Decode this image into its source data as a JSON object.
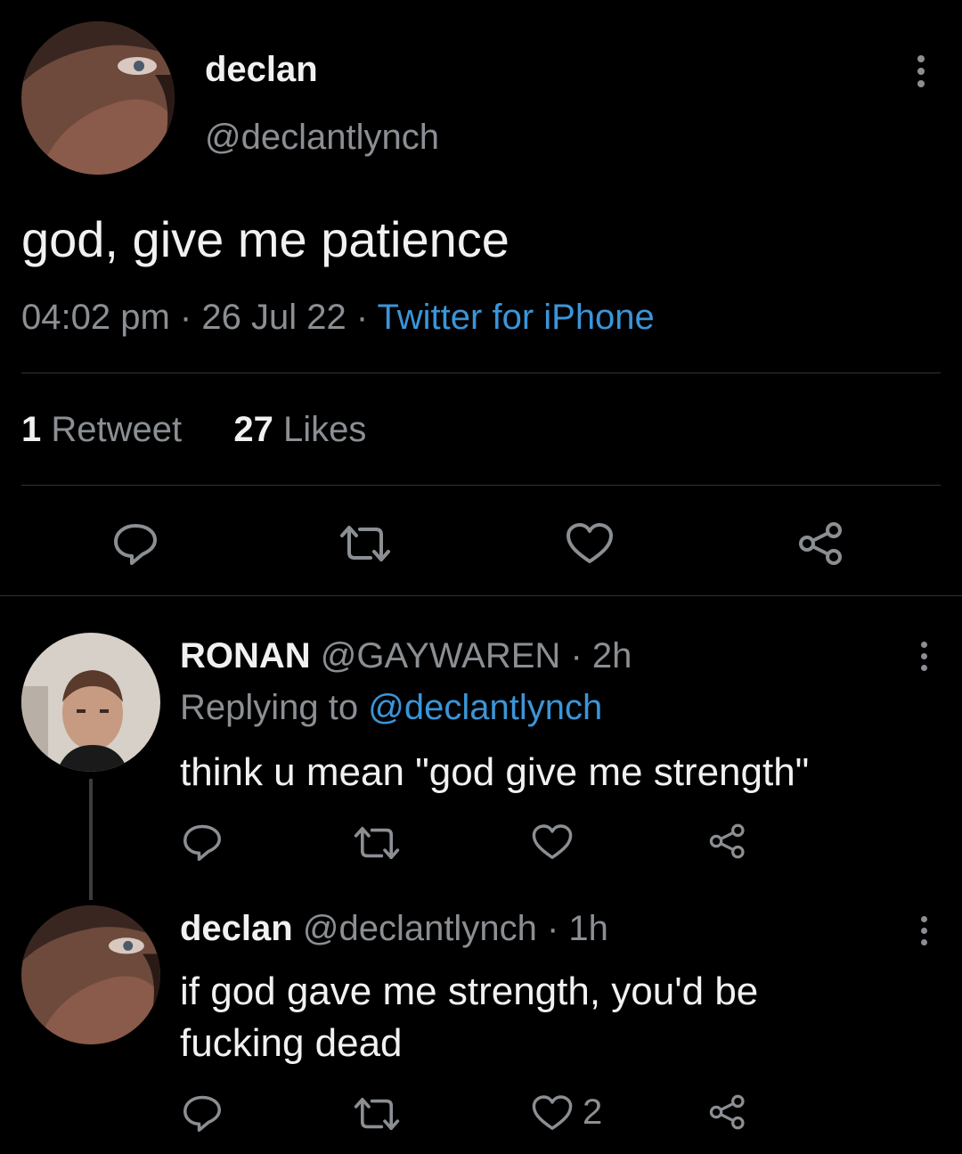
{
  "main_tweet": {
    "author_name": "declan",
    "author_handle": "@declantlynch",
    "text": "god, give me patience",
    "time": "04:02 pm",
    "date": "26 Jul 22",
    "source": "Twitter for iPhone",
    "sep": "·",
    "retweet_count": "1",
    "retweet_label": "Retweet",
    "like_count": "27",
    "like_label": "Likes",
    "icons": [
      "reply-icon",
      "retweet-icon",
      "like-icon",
      "share-icon"
    ]
  },
  "replies": [
    {
      "author_name": "RONAN",
      "author_handle": "@GAYWAREN",
      "sep": "·",
      "time": "2h",
      "replying_prefix": "Replying to",
      "replying_handle": "@declantlynch",
      "text": "think u mean \"god give me strength\"",
      "like_count": ""
    },
    {
      "author_name": "declan",
      "author_handle": "@declantlynch",
      "sep": "·",
      "time": "1h",
      "text_line1": "if god gave me strength, you'd be",
      "text_line2": "fucking dead",
      "like_count": "2"
    }
  ],
  "colors": {
    "background": "#000000",
    "text": "#e7e9ea",
    "muted": "#8b8f93",
    "link": "#3b95d8",
    "divider": "#2f3336"
  }
}
